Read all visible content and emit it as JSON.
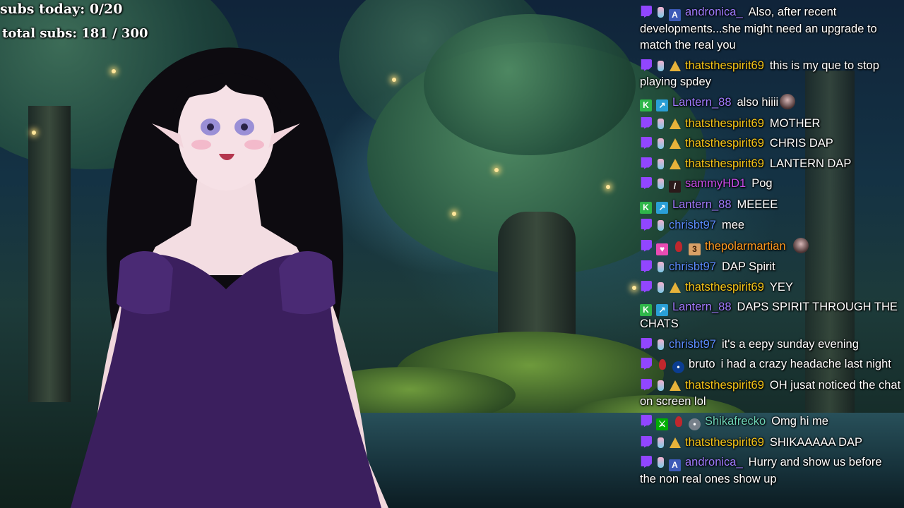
{
  "overlay": {
    "subs_today": "subs today: 0/20",
    "total_subs": "total subs: 181 / 300"
  },
  "colors": {
    "twitch_purple": "#9146ff",
    "andronica": "#a07cff",
    "thatsthespirit69": "#f5c518",
    "lantern": "#a17bff",
    "sammy": "#c64be6",
    "chrisbt": "#5b8cff",
    "polarmartian": "#ff9a1f",
    "bruto": "#ffffff",
    "shikafrecko": "#6ed5b8"
  },
  "chat": [
    {
      "user": "andronica_",
      "color": "#a07cff",
      "badges": [
        "twitch-icon",
        "bottle-icon",
        "letter-a-icon"
      ],
      "text": "Also, after recent developments...she might need an upgrade to match the real you"
    },
    {
      "user": "thatsthespirit69",
      "color": "#f5c518",
      "badges": [
        "twitch-icon",
        "bottle-icon",
        "gold-badge-icon"
      ],
      "text": "this is my que to stop playing spdey"
    },
    {
      "user": "Lantern_88",
      "color": "#a17bff",
      "badges": [
        "kick-icon",
        "arrow-badge-icon"
      ],
      "text": "also hiiii",
      "emote": true
    },
    {
      "user": "thatsthespirit69",
      "color": "#f5c518",
      "badges": [
        "twitch-icon",
        "bottle-icon",
        "gold-badge-icon"
      ],
      "text": "MOTHER"
    },
    {
      "user": "thatsthespirit69",
      "color": "#f5c518",
      "badges": [
        "twitch-icon",
        "bottle-icon",
        "gold-badge-icon"
      ],
      "text": "CHRIS DAP"
    },
    {
      "user": "thatsthespirit69",
      "color": "#f5c518",
      "badges": [
        "twitch-icon",
        "bottle-icon",
        "gold-badge-icon"
      ],
      "text": "LANTERN DAP"
    },
    {
      "user": "sammyHD1",
      "color": "#c64be6",
      "badges": [
        "twitch-icon",
        "bottle-icon",
        "sword-badge-icon"
      ],
      "text": "Pog"
    },
    {
      "user": "Lantern_88",
      "color": "#a17bff",
      "badges": [
        "kick-icon",
        "arrow-badge-icon"
      ],
      "text": "MEEEE"
    },
    {
      "user": "chrisbt97",
      "color": "#5b8cff",
      "badges": [
        "twitch-icon",
        "bottle-icon"
      ],
      "text": "mee"
    },
    {
      "user": "thepolarmartian",
      "color": "#ff9a1f",
      "badges": [
        "twitch-icon",
        "heart-badge-icon",
        "red-drop-icon",
        "number-badge-icon"
      ],
      "text": "",
      "emote": true
    },
    {
      "user": "chrisbt97",
      "color": "#5b8cff",
      "badges": [
        "twitch-icon",
        "bottle-icon"
      ],
      "text": "DAP Spirit"
    },
    {
      "user": "thatsthespirit69",
      "color": "#f5c518",
      "badges": [
        "twitch-icon",
        "bottle-icon",
        "gold-badge-icon"
      ],
      "text": "YEY"
    },
    {
      "user": "Lantern_88",
      "color": "#a17bff",
      "badges": [
        "kick-icon",
        "arrow-badge-icon"
      ],
      "text": "DAPS SPIRIT THROUGH THE CHATS"
    },
    {
      "user": "chrisbt97",
      "color": "#5b8cff",
      "badges": [
        "twitch-icon",
        "bottle-icon"
      ],
      "text": "it's a eepy sunday evening"
    },
    {
      "user": "bruto",
      "color": "#ffffff",
      "badges": [
        "twitch-icon",
        "red-drop-icon",
        "nasa-badge-icon"
      ],
      "text": "i had a crazy headache last night"
    },
    {
      "user": "thatsthespirit69",
      "color": "#f5c518",
      "badges": [
        "twitch-icon",
        "bottle-icon",
        "gold-badge-icon"
      ],
      "text": "OH jusat noticed the chat on screen lol"
    },
    {
      "user": "Shikafrecko",
      "color": "#6ed5b8",
      "badges": [
        "twitch-icon",
        "mod-sword-icon",
        "red-drop-icon",
        "gray-badge-icon"
      ],
      "text": "Omg hi me"
    },
    {
      "user": "thatsthespirit69",
      "color": "#f5c518",
      "badges": [
        "twitch-icon",
        "bottle-icon",
        "gold-badge-icon"
      ],
      "text": "SHIKAAAAA DAP"
    },
    {
      "user": "andronica_",
      "color": "#a07cff",
      "badges": [
        "twitch-icon",
        "bottle-icon",
        "letter-a-icon"
      ],
      "text": "Hurry and show us before the non real ones show up"
    }
  ]
}
